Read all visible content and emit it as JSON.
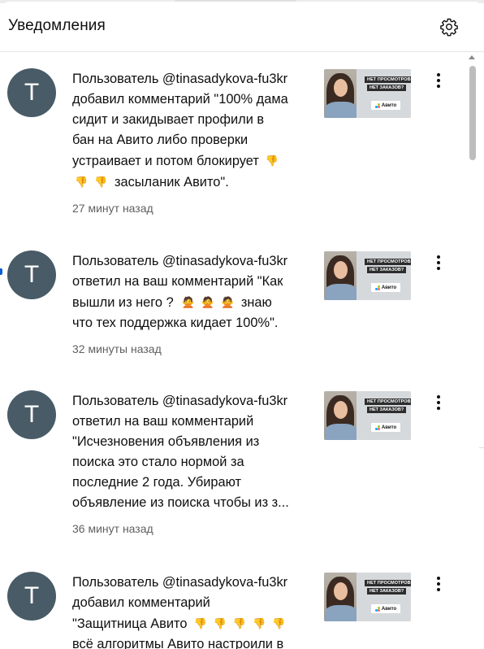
{
  "header": {
    "title": "Уведомления",
    "settings_icon": "gear-icon"
  },
  "notifications": [
    {
      "avatar_letter": "T",
      "lines": [
        "Пользователь @tinasadykova-fu3kr",
        "добавил комментарий \"100% дама",
        "сидит и закидывает профили в",
        "бан на Авито либо проверки",
        "устраивает и потом блокирует",
        "засыланик Авито\"."
      ],
      "time": "27 минут назад",
      "thumb": {
        "line1": "НЕТ ПРОСМОТРОВ?",
        "line2": "НЕТ ЗАКАЗОВ?",
        "logo": "Авито"
      }
    },
    {
      "avatar_letter": "T",
      "lines": [
        "Пользователь @tinasadykova-fu3kr",
        "ответил на ваш комментарий \"Как",
        "вышли из него ?",
        "знаю",
        "что тех поддержка кидает 100%\"."
      ],
      "time": "32 минуты назад",
      "thumb": {
        "line1": "НЕТ ПРОСМОТРОВ?",
        "line2": "НЕТ ЗАКАЗОВ?",
        "logo": "Авито"
      }
    },
    {
      "avatar_letter": "T",
      "lines": [
        "Пользователь @tinasadykova-fu3kr",
        "ответил на ваш комментарий",
        "\"Исчезновения объявления из",
        "поиска это стало нормой за",
        "последние 2 года. Убирают",
        "объявление из поиска чтобы из з..."
      ],
      "time": "36 минут назад",
      "thumb": {
        "line1": "НЕТ ПРОСМОТРОВ?",
        "line2": "НЕТ ЗАКАЗОВ?",
        "logo": "Авито"
      }
    },
    {
      "avatar_letter": "T",
      "lines": [
        "Пользователь @tinasadykova-fu3kr",
        "добавил комментарий",
        "\"Защитница Авито",
        "всё алгоритмы Авито настроили в"
      ],
      "time": "",
      "thumb": {
        "line1": "НЕТ ПРОСМОТРОВ?",
        "line2": "НЕТ ЗАКАЗОВ?",
        "logo": "Авито"
      }
    }
  ],
  "icons": {
    "thumbs_down": "thumbs-down-icon",
    "woman_gesture": "woman-gesturing-icon",
    "more": "more-vertical-icon"
  }
}
